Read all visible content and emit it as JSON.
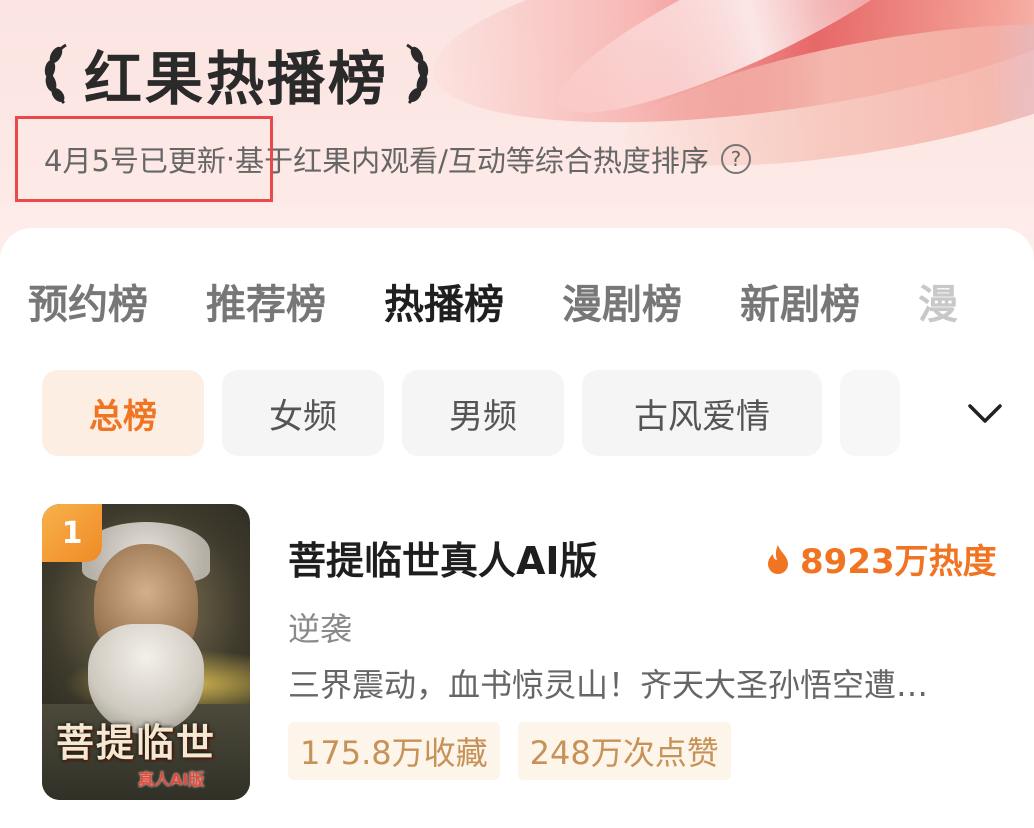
{
  "header": {
    "title": "红果热播榜",
    "update_note": "4月5号已更新",
    "separator": "·",
    "ranking_basis": "基于红果内观看/互动等综合热度排序",
    "help_icon": "?"
  },
  "tabs": [
    {
      "label": "预约榜",
      "active": false
    },
    {
      "label": "推荐榜",
      "active": false
    },
    {
      "label": "热播榜",
      "active": true
    },
    {
      "label": "漫剧榜",
      "active": false
    },
    {
      "label": "新剧榜",
      "active": false
    },
    {
      "label": "漫",
      "active": false
    }
  ],
  "chips": [
    {
      "label": "总榜",
      "active": true
    },
    {
      "label": "女频",
      "active": false
    },
    {
      "label": "男频",
      "active": false
    },
    {
      "label": "古风爱情",
      "active": false
    }
  ],
  "items": [
    {
      "rank": "1",
      "title": "菩提临世真人AI版",
      "heat": "8923万热度",
      "genre": "逆袭",
      "description": "三界震动，血书惊灵山！齐天大圣孙悟空遭…",
      "tags": [
        "175.8万收藏",
        "248万次点赞"
      ],
      "cover_text": "菩提临世",
      "cover_subtext": "真人AI版"
    }
  ],
  "colors": {
    "accent": "#f07422",
    "highlight_box": "#e84a4a",
    "tag_text": "#c69258"
  }
}
